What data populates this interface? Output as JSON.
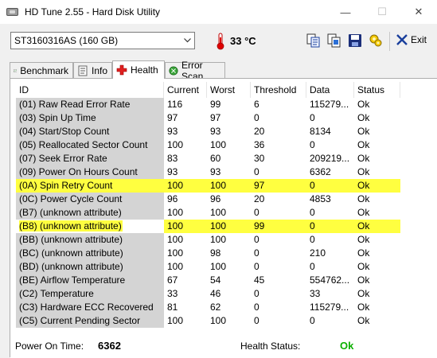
{
  "window": {
    "title": "HD Tune 2.55 - Hard Disk Utility",
    "min_symbol": "—",
    "max_symbol": "☐",
    "close_symbol": "✕"
  },
  "toolbar": {
    "drive": "ST3160316AS (160 GB)",
    "temperature": "33 °C",
    "exit_label": "Exit"
  },
  "tabs": [
    {
      "label": "Benchmark",
      "icon": "benchmark-icon"
    },
    {
      "label": "Info",
      "icon": "info-icon"
    },
    {
      "label": "Health",
      "icon": "health-cross-icon",
      "active": true
    },
    {
      "label": "Error Scan",
      "icon": "error-scan-icon"
    }
  ],
  "table": {
    "columns": [
      "ID",
      "Current",
      "Worst",
      "Threshold",
      "Data",
      "Status"
    ],
    "rows": [
      [
        "(01) Raw Read Error Rate",
        "116",
        "99",
        "6",
        "115279...",
        "Ok"
      ],
      [
        "(03) Spin Up Time",
        "97",
        "97",
        "0",
        "0",
        "Ok"
      ],
      [
        "(04) Start/Stop Count",
        "93",
        "93",
        "20",
        "8134",
        "Ok"
      ],
      [
        "(05) Reallocated Sector Count",
        "100",
        "100",
        "36",
        "0",
        "Ok"
      ],
      [
        "(07) Seek Error Rate",
        "83",
        "60",
        "30",
        "209219...",
        "Ok"
      ],
      [
        "(09) Power On Hours Count",
        "93",
        "93",
        "0",
        "6362",
        "Ok"
      ],
      [
        "(0A) Spin Retry Count",
        "100",
        "100",
        "97",
        "0",
        "Ok"
      ],
      [
        "(0C) Power Cycle Count",
        "96",
        "96",
        "20",
        "4853",
        "Ok"
      ],
      [
        "(B7) (unknown attribute)",
        "100",
        "100",
        "0",
        "0",
        "Ok"
      ],
      [
        "(B8) (unknown attribute)",
        "100",
        "100",
        "99",
        "0",
        "Ok"
      ],
      [
        "(BB) (unknown attribute)",
        "100",
        "100",
        "0",
        "0",
        "Ok"
      ],
      [
        "(BC) (unknown attribute)",
        "100",
        "98",
        "0",
        "210",
        "Ok"
      ],
      [
        "(BD) (unknown attribute)",
        "100",
        "100",
        "0",
        "0",
        "Ok"
      ],
      [
        "(BE) Airflow Temperature",
        "67",
        "54",
        "45",
        "554762...",
        "Ok"
      ],
      [
        "(C2) Temperature",
        "33",
        "46",
        "0",
        "33",
        "Ok"
      ],
      [
        "(C3) Hardware ECC Recovered",
        "81",
        "62",
        "0",
        "115279...",
        "Ok"
      ],
      [
        "(C5) Current Pending Sector",
        "100",
        "100",
        "0",
        "0",
        "Ok"
      ]
    ],
    "highlighted_rows": [
      "(0A) Spin Retry Count",
      "(B8) (unknown attribute)"
    ],
    "highlight_color": "#ffff40"
  },
  "status": {
    "power_on_label": "Power On Time:",
    "power_on_value": "6362",
    "health_label": "Health Status:",
    "health_value": "Ok",
    "health_color": "#0bb000"
  }
}
